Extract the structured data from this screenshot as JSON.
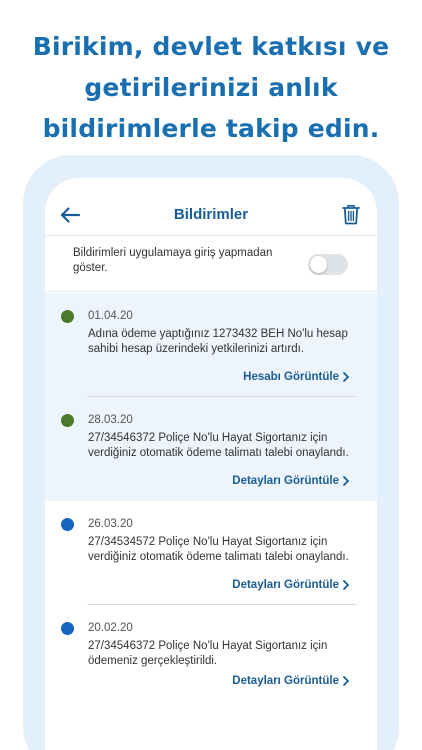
{
  "headline": {
    "line1": "Birikim, devlet katkısı ve",
    "line2": "getirilerinizi anlık",
    "line3": "bildirimlerle takip edin."
  },
  "header": {
    "title": "Bildirimler",
    "back_icon": "arrow-left-icon",
    "delete_icon": "trash-icon"
  },
  "setting": {
    "label": "Bildirimleri uygulamaya giriş yapmadan göster.",
    "enabled": false
  },
  "colors": {
    "accent": "#1a5d96",
    "headline": "#1a6fb0",
    "unread_bg": "#edf4fb",
    "dot_green": "#4a7a2a",
    "dot_blue": "#1565c0"
  },
  "notifications": [
    {
      "date": "01.04.20",
      "message": "Adına ödeme yaptığınız 1273432 BEH No'lu hesap sahibi hesap üzerindeki yetkilerinizi artırdı.",
      "link": "Hesabı Görüntüle",
      "dot_color": "#4a7a2a",
      "unread": true
    },
    {
      "date": "28.03.20",
      "message": "27/34546372 Poliçe No'lu Hayat Sigortanız için verdiğiniz otomatik ödeme talimatı talebi onaylandı.",
      "link": "Detayları Görüntüle",
      "dot_color": "#4a7a2a",
      "unread": true
    },
    {
      "date": "26.03.20",
      "message": "27/34534572 Poliçe No'lu Hayat Sigortanız için verdiğiniz otomatik ödeme talimatı talebi onaylandı.",
      "link": "Detayları Görüntüle",
      "dot_color": "#1565c0",
      "unread": false
    },
    {
      "date": "20.02.20",
      "message": "27/34546372 Poliçe No'lu Hayat Sigortanız için ödemeniz gerçekleştirildi.",
      "link": "Detayları Görüntüle",
      "dot_color": "#1565c0",
      "unread": false
    }
  ]
}
